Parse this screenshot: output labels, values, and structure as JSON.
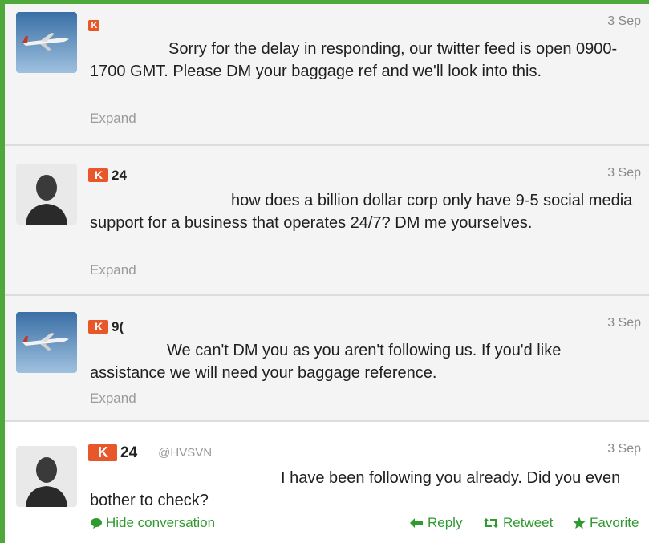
{
  "tweets": [
    {
      "klout": "",
      "date": "3 Sep",
      "text": "Sorry for the delay in responding, our twitter feed is open 0900-1700 GMT. Please DM your baggage ref and we'll look into this.",
      "expand": "Expand"
    },
    {
      "klout": "24",
      "date": "3 Sep",
      "text": "how does a billion dollar corp only have 9-5 social media support for a business that operates 24/7? DM me yourselves.",
      "expand": "Expand"
    },
    {
      "klout": "9(",
      "date": "3 Sep",
      "text": "We can't DM you as you aren't following us. If you'd like assistance we will need your baggage reference.",
      "expand": "Expand"
    },
    {
      "klout": "24",
      "handle": "@HVSVN",
      "date": "3 Sep",
      "text": "I have been following you already. Did you even bother to check?",
      "hide_conversation": "Hide conversation",
      "reply": "Reply",
      "retweet": "Retweet",
      "favorite": "Favorite"
    }
  ],
  "colors": {
    "accent_green": "#2f9a2f",
    "klout_orange": "#e8572a",
    "border_green": "#4fa83a"
  },
  "icons": [
    "airplane-avatar",
    "person-avatar",
    "klout-icon",
    "speech-bubble-icon",
    "reply-icon",
    "retweet-icon",
    "star-icon"
  ]
}
